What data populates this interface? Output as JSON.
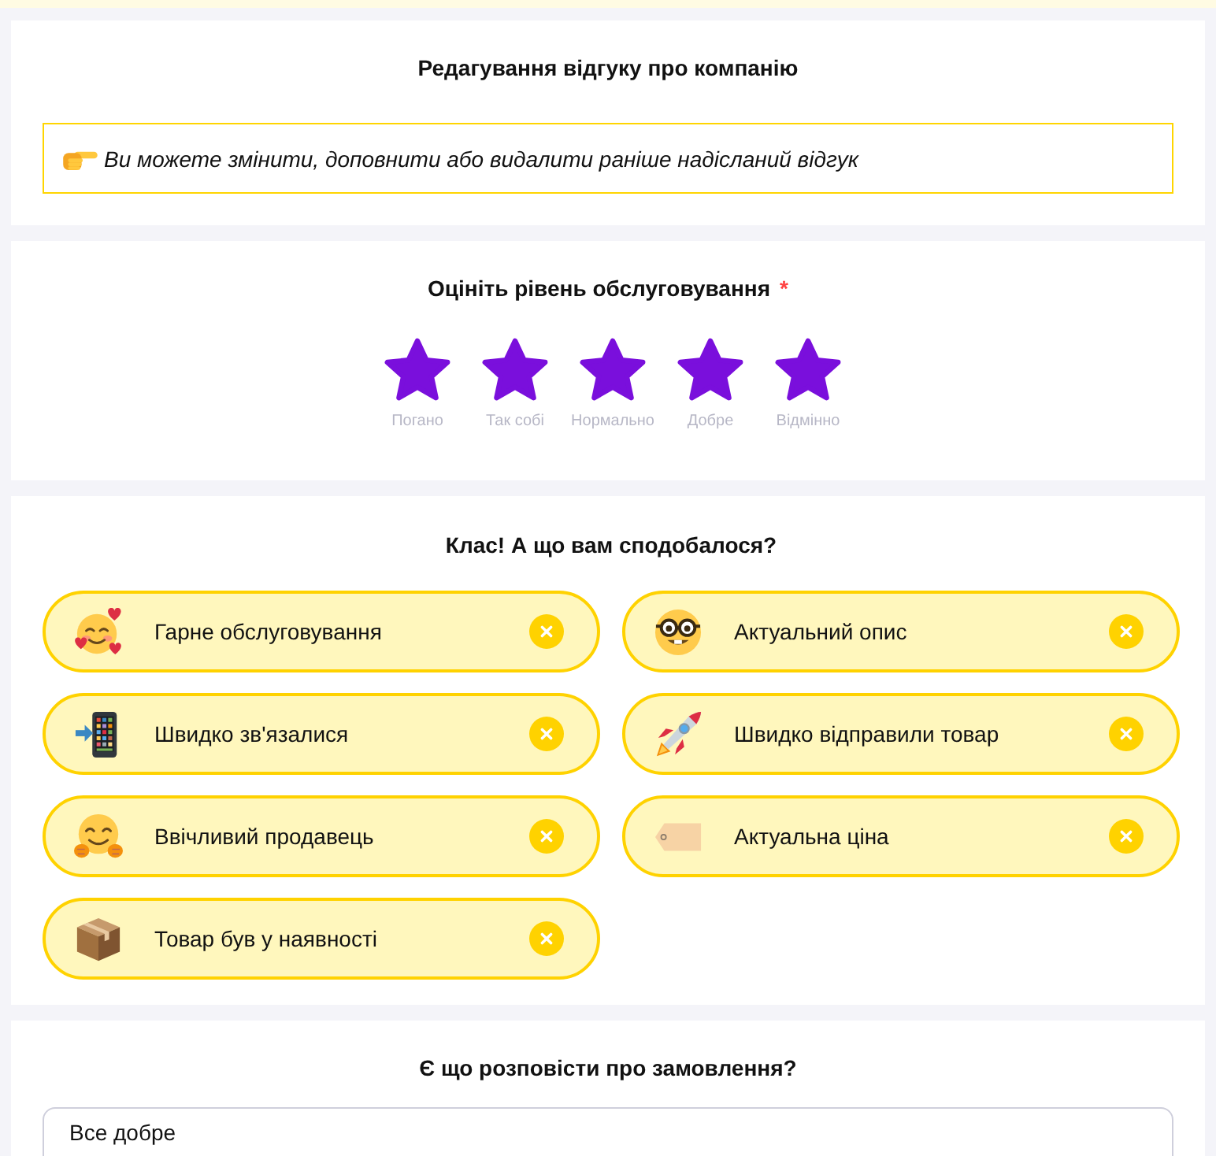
{
  "header": {
    "title": "Редагування відгуку про компанію",
    "notice": "Ви можете змінити, доповнити або видалити раніше надісланий відгук"
  },
  "rating": {
    "title": "Оцініть рівень обслуговування",
    "required_mark": "*",
    "stars": 5,
    "labels": [
      "Погано",
      "Так собі",
      "Нормально",
      "Добре",
      "Відмінно"
    ]
  },
  "likes": {
    "title": "Клас! А що вам сподобалося?",
    "options": [
      {
        "label": "Гарне обслуговування",
        "selected": true
      },
      {
        "label": "Актуальний опис",
        "selected": true
      },
      {
        "label": "Швидко зв'язалися",
        "selected": true
      },
      {
        "label": "Швидко відправили товар",
        "selected": true
      },
      {
        "label": "Ввічливий продавець",
        "selected": true
      },
      {
        "label": "Актуальна ціна",
        "selected": true
      },
      {
        "label": "Товар був у наявності",
        "selected": true
      }
    ]
  },
  "comment": {
    "title": "Є що розповісти про замовлення?",
    "value": "Все добре"
  }
}
